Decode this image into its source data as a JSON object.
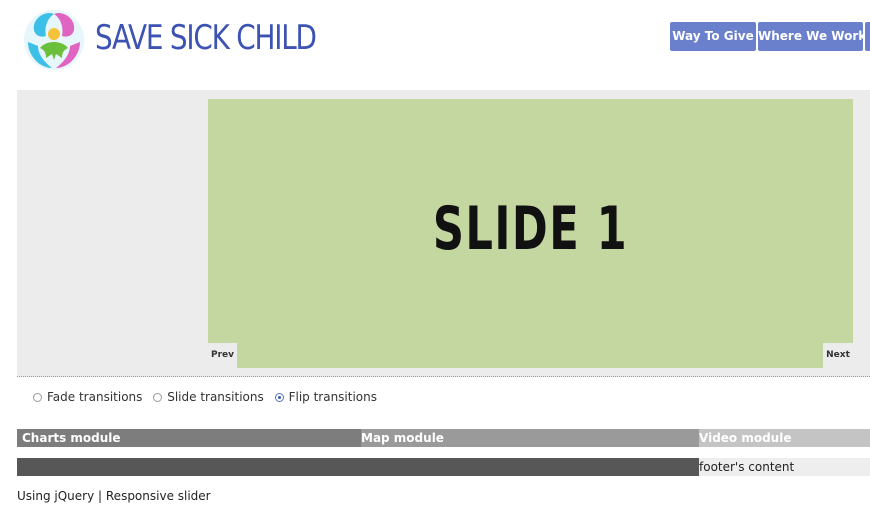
{
  "header": {
    "brand": "SAVE SICK CHILD",
    "logo_icon": "child-globe-logo-icon",
    "nav": [
      "Way To Give",
      "Where We Work",
      ""
    ]
  },
  "slider": {
    "title": "SLIDE 1",
    "prev": "Prev",
    "next": "Next"
  },
  "transitions": {
    "options": [
      {
        "label": "Fade transitions",
        "checked": false
      },
      {
        "label": "Slide transitions",
        "checked": false
      },
      {
        "label": "Flip transitions",
        "checked": true
      }
    ]
  },
  "modules": {
    "charts": "Charts module",
    "map": "Map module",
    "video": "Video module"
  },
  "footer": {
    "content": "footer's content",
    "credits": "Using jQuery | Responsive slider"
  },
  "colors": {
    "nav_button": "#6b80cd",
    "brand_text": "#3d53b3",
    "slide_bg": "#c4d7a0"
  }
}
